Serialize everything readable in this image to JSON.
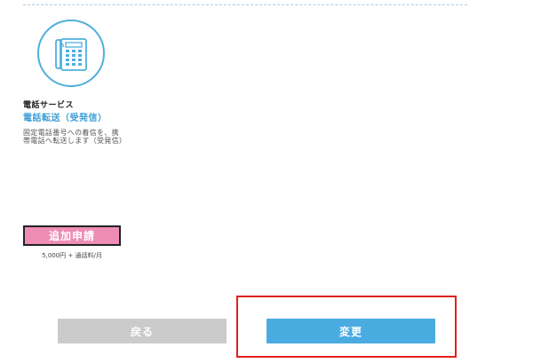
{
  "service": {
    "icon": "telephone-icon",
    "category": "電話サービス",
    "name": "電話転送（受発信）",
    "description": "固定電話番号への着信を、携帯電話へ転送します（受発信）",
    "apply_label": "追加申請",
    "price": "5,000円 + 通話料/月"
  },
  "actions": {
    "back_label": "戻る",
    "change_label": "変更"
  },
  "colors": {
    "accent_blue": "#4aabe0",
    "apply_pink": "#ee8cb5",
    "highlight_red": "#e0201e",
    "back_gray": "#cbcbcb"
  }
}
